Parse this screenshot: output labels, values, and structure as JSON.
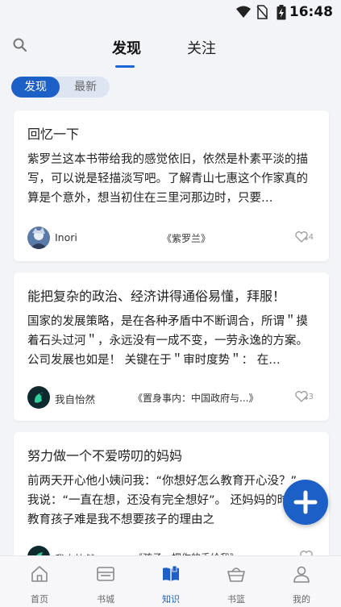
{
  "status_bar": {
    "time": "16:48"
  },
  "header": {
    "tabs": [
      {
        "label": "发现",
        "active": true
      },
      {
        "label": "关注",
        "active": false
      }
    ]
  },
  "segment": {
    "items": [
      "发现",
      "最新"
    ],
    "active_index": 0
  },
  "posts": [
    {
      "title": "回忆一下",
      "excerpt": "紫罗兰这本书带给我的感觉依旧，依然是朴素平淡的描写，可以说是轻描淡写吧。了解青山七惠这个作家真的算是个意外，想当初住在三里河那边时，只要…",
      "author": "Inori",
      "book": "《紫罗兰》",
      "likes": "4"
    },
    {
      "title": "能把复杂的政治、经济讲得通俗易懂，拜服！",
      "excerpt": "国家的发展策略，是在各种矛盾中不断调合，所谓＂摸着石头过河＂，永远没有一成不变，一劳永逸的方案。 公司发展也如是！ 关键在于＂审时度势＂： 在…",
      "author": "我自怡然",
      "book": "《置身事内：中国政府与...》",
      "likes": "3"
    },
    {
      "title": "努力做一个不爱唠叨的妈妈",
      "excerpt": "前两天开心他小姨问我：“你想好怎么教育开心没？”，我说：“一直在想，还没有完全想好”。 还妈妈的时候，教育孩子难是我不想要孩子的理由之",
      "author": "我自怡然",
      "book": "《孩子，把你的手给我》",
      "likes": ""
    }
  ],
  "bottom_nav": [
    {
      "label": "首页",
      "icon": "home-icon",
      "active": false
    },
    {
      "label": "书城",
      "icon": "bookstore-icon",
      "active": false
    },
    {
      "label": "知识",
      "icon": "knowledge-icon",
      "active": true
    },
    {
      "label": "书篮",
      "icon": "basket-icon",
      "active": false
    },
    {
      "label": "我的",
      "icon": "profile-icon",
      "active": false
    }
  ],
  "colors": {
    "accent": "#1b5fc7",
    "background": "#f3f4f7",
    "card": "#ffffff"
  }
}
